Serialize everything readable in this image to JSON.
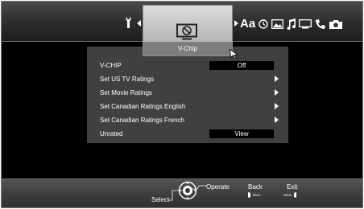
{
  "topbar": {
    "icons": [
      "wrench-icon",
      "monitor-no-signal-icon",
      "text-size-icon",
      "clock-icon",
      "picture-icon",
      "music-icon",
      "tv-icon",
      "phone-icon",
      "camera-icon"
    ],
    "text_icon_label": "Aa"
  },
  "selected_tab": {
    "icon": "monitor-no-signal-icon",
    "label": "V-Chip"
  },
  "menu": {
    "items": [
      {
        "label": "V-CHIP",
        "value": "Off",
        "has_arrow": false
      },
      {
        "label": "Set US TV Ratings",
        "value": "",
        "has_arrow": true
      },
      {
        "label": "Set Movie Ratings",
        "value": "",
        "has_arrow": true
      },
      {
        "label": "Set Canadian Ratings English",
        "value": "",
        "has_arrow": true
      },
      {
        "label": "Set Canadian Ratings French",
        "value": "",
        "has_arrow": true
      },
      {
        "label": "Unrated",
        "value": "View",
        "has_arrow": false
      }
    ]
  },
  "bottombar": {
    "select_label": "Select",
    "operate_label": "Operate",
    "back_label": "Back",
    "back_key": "BACK",
    "exit_label": "Exit",
    "exit_key": "MENU"
  }
}
